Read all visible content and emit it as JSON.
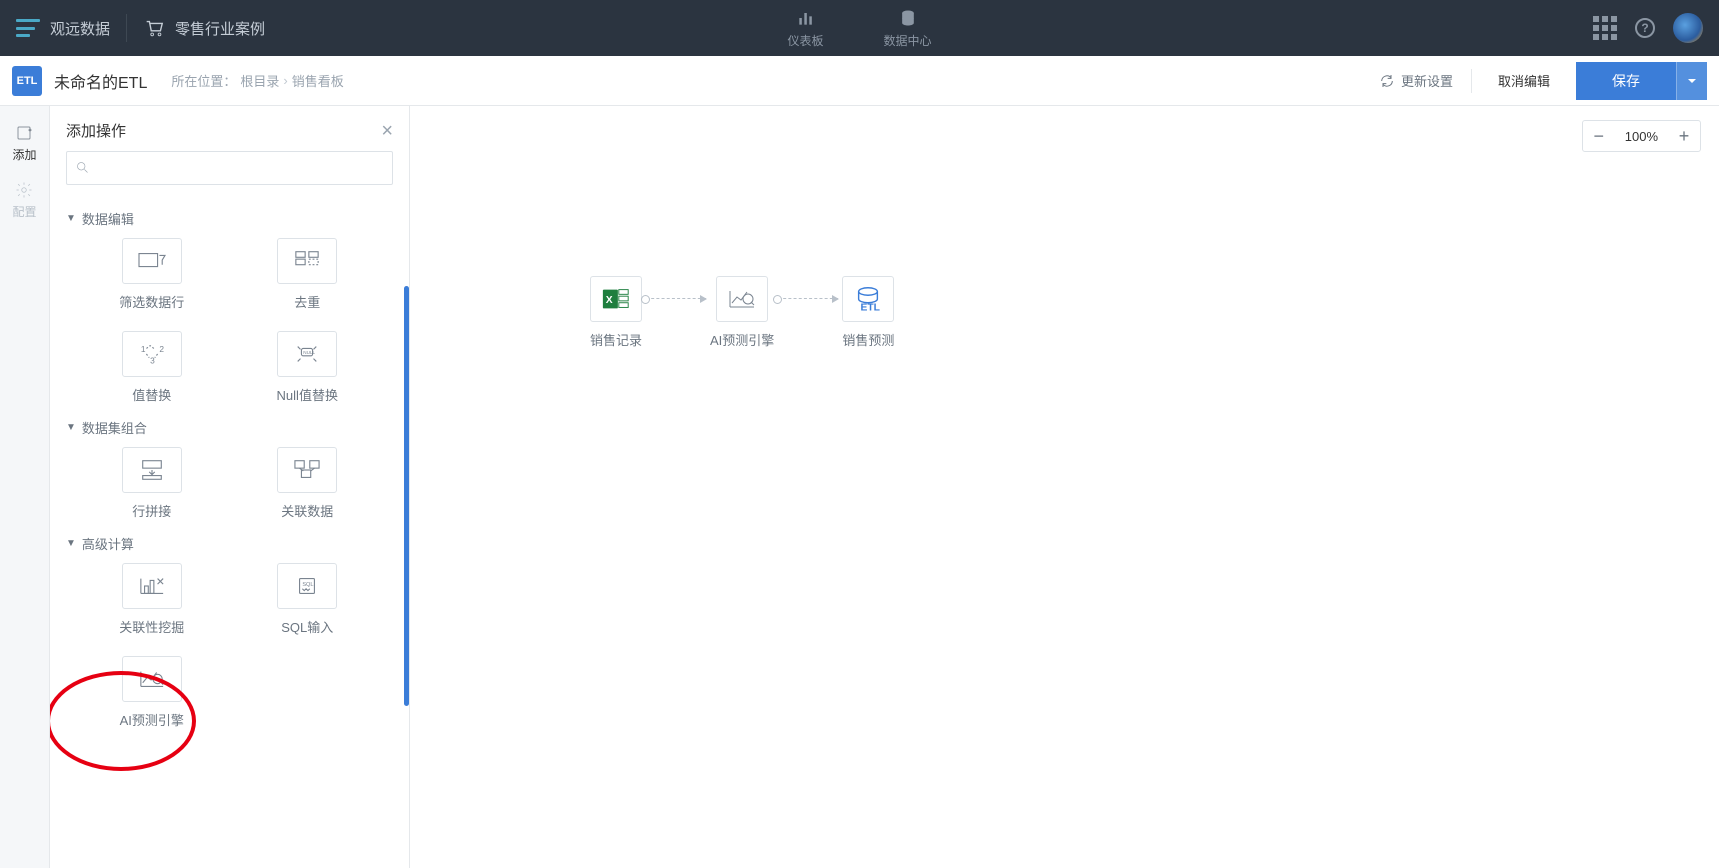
{
  "header": {
    "brand": "观远数据",
    "project": "零售行业案例",
    "tabs": [
      {
        "label": "仪表板"
      },
      {
        "label": "数据中心"
      }
    ]
  },
  "subheader": {
    "etl_badge": "ETL",
    "title": "未命名的ETL",
    "location_label": "所在位置：",
    "breadcrumb": [
      "根目录",
      "销售看板"
    ],
    "refresh": "更新设置",
    "cancel": "取消编辑",
    "save": "保存"
  },
  "left_rail": [
    {
      "label": "添加"
    },
    {
      "label": "配置"
    }
  ],
  "ops_panel": {
    "title": "添加操作",
    "search_placeholder": "",
    "groups": [
      {
        "title": "数据编辑",
        "items": [
          {
            "label": "筛选数据行",
            "icon": "filter"
          },
          {
            "label": "去重",
            "icon": "dedup"
          },
          {
            "label": "值替换",
            "icon": "replace"
          },
          {
            "label": "Null值替换",
            "icon": "null-replace"
          }
        ]
      },
      {
        "title": "数据集组合",
        "items": [
          {
            "label": "行拼接",
            "icon": "row-concat"
          },
          {
            "label": "关联数据",
            "icon": "join"
          }
        ]
      },
      {
        "title": "高级计算",
        "items": [
          {
            "label": "关联性挖掘",
            "icon": "mining"
          },
          {
            "label": "SQL输入",
            "icon": "sql"
          },
          {
            "label": "AI预测引擎",
            "icon": "ai-predict"
          }
        ]
      }
    ]
  },
  "canvas": {
    "zoom": "100%",
    "nodes": [
      {
        "label": "销售记录",
        "type": "excel"
      },
      {
        "label": "AI预测引擎",
        "type": "ai"
      },
      {
        "label": "销售预测",
        "type": "etl-out"
      }
    ]
  }
}
